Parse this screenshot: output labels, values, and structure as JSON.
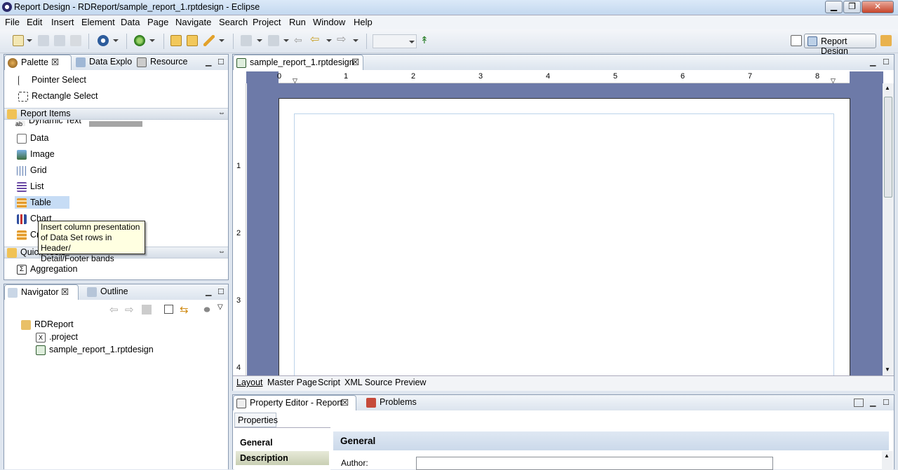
{
  "window": {
    "title": "Report Design - RDReport/sample_report_1.rptdesign - Eclipse",
    "min": "▁",
    "max": "❐",
    "close": "✕"
  },
  "menu": [
    "File",
    "Edit",
    "Insert",
    "Element",
    "Data",
    "Page",
    "Navigate",
    "Search",
    "Project",
    "Run",
    "Window",
    "Help"
  ],
  "perspective": {
    "label": "Report Design"
  },
  "palette": {
    "tabs": [
      "Palette",
      "Data Explo",
      "Resource"
    ],
    "pointer": "Pointer Select",
    "rect": "Rectangle Select",
    "report_items": "Report Items",
    "items": [
      "Dynamic Text",
      "Data",
      "Image",
      "Grid",
      "List",
      "Table",
      "Chart",
      "Cr"
    ],
    "quick_tools": "Quick Tools",
    "aggregation": "Aggregation",
    "tooltip": [
      "Insert column presentation",
      "of Data Set rows in Header/",
      "Detail/Footer bands"
    ]
  },
  "navigator": {
    "tabs": [
      "Navigator",
      "Outline"
    ],
    "project": "RDReport",
    "files": [
      ".project",
      "sample_report_1.rptdesign"
    ]
  },
  "editor": {
    "tab": "sample_report_1.rptdesign",
    "ruler_h": [
      "0",
      "1",
      "2",
      "3",
      "4",
      "5",
      "6",
      "7",
      "8"
    ],
    "ruler_v": [
      "1",
      "2",
      "3",
      "4"
    ],
    "bottom_tabs": [
      "Layout",
      "Master Page",
      "Script",
      "XML Source",
      "Preview"
    ]
  },
  "props": {
    "tabs": [
      "Property Editor - Report",
      "Problems"
    ],
    "properties_tab": "Properties",
    "side": [
      "General",
      "Description"
    ],
    "section": "General",
    "author_label": "Author:"
  }
}
